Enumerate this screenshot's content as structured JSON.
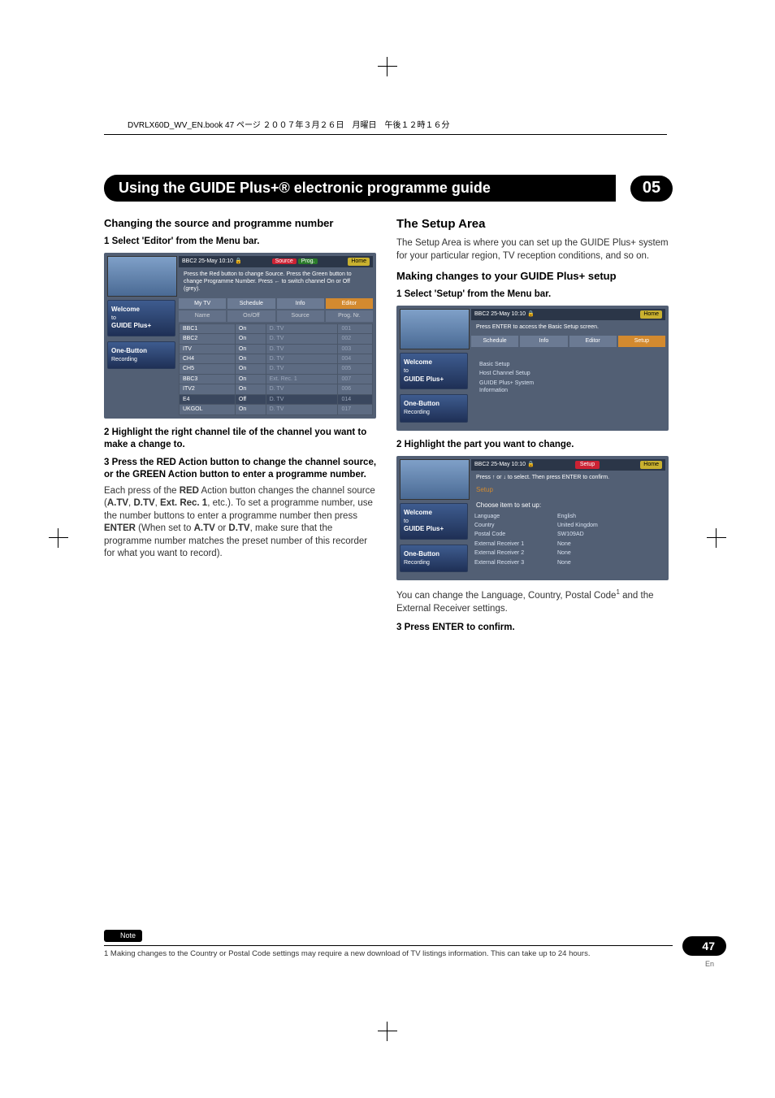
{
  "file_header": "DVRLX60D_WV_EN.book  47 ページ  ２００７年３月２６日　月曜日　午後１２時１６分",
  "page_number": "47",
  "page_lang": "En",
  "chapter_number": "05",
  "chapter_title": "Using the GUIDE Plus+® electronic programme guide",
  "left_col": {
    "heading": "Changing the source and programme number",
    "step1": "1   Select 'Editor' from the Menu bar.",
    "step2": "2   Highlight the right channel tile of the channel you want to make a change to.",
    "step3": "3   Press the RED Action button to change the channel source, or the GREEN Action button to enter a programme number.",
    "body1a": "Each press of the ",
    "body1b": " Action button changes the channel source (",
    "body1c": ", etc.). To set a programme number, use the number buttons to enter a programme number then press ",
    "body1d": " (When set to ",
    "body1e": " or ",
    "body1f": ", make sure that the programme number matches the preset number of this recorder for what you want to record).",
    "RED": "RED",
    "ATV": "A.TV",
    "DTV": "D.TV",
    "EXTREC": "Ext. Rec. 1",
    "ENTER": "ENTER"
  },
  "right_col": {
    "heading1": "The Setup Area",
    "body1": "The Setup Area is where you can set up the GUIDE Plus+ system for your particular region, TV reception conditions, and so on.",
    "heading2": "Making changes to your GUIDE Plus+ setup",
    "step1": "1   Select 'Setup' from the Menu bar.",
    "step2": "2   Highlight the part you want to change.",
    "body2a": "You can change the Language, Country, Postal Code",
    "body2b": " and the External Receiver settings.",
    "step3": "3   Press ENTER to confirm."
  },
  "note": {
    "label": "Note",
    "text": "1 Making changes to the Country or Postal Code settings may require a new download of TV listings information. This can take up to 24 hours."
  },
  "screenshots": {
    "common": {
      "status": "BBC2   25-May  10:10",
      "home": "Home",
      "welcome": "Welcome",
      "to": "to",
      "guide": "GUIDE Plus+",
      "onebutton": "One-Button",
      "recording": "Recording"
    },
    "editor": {
      "hint": "Press the Red button to change Source. Press the Green button to change Programme Number. Press ← to switch channel On or Off (grey).",
      "action_source": "Source",
      "action_prog": "Prog.",
      "tabs": [
        "My TV",
        "Schedule",
        "Info",
        "Editor"
      ],
      "subtabs": [
        "Name",
        "On/Off",
        "Source",
        "Prog. Nr."
      ],
      "rows": [
        [
          "BBC1",
          "On",
          "D. TV",
          "001"
        ],
        [
          "BBC2",
          "On",
          "D. TV",
          "002"
        ],
        [
          "ITV",
          "On",
          "D. TV",
          "003"
        ],
        [
          "CH4",
          "On",
          "D. TV",
          "004"
        ],
        [
          "CH5",
          "On",
          "D. TV",
          "005"
        ],
        [
          "BBC3",
          "On",
          "Ext. Rec. 1",
          "007"
        ],
        [
          "ITV2",
          "On",
          "D. TV",
          "006"
        ],
        [
          "E4",
          "Off",
          "D. TV",
          "014"
        ],
        [
          "UKGOL",
          "On",
          "D. TV",
          "017"
        ]
      ],
      "selected_row": 7
    },
    "setup1": {
      "hint": "Press ENTER to access the Basic Setup screen.",
      "tabs": [
        "Schedule",
        "Info",
        "Editor",
        "Setup"
      ],
      "items": [
        "Basic Setup",
        "Host Channel Setup",
        "GUIDE Plus+ System Information"
      ]
    },
    "setup2": {
      "hint": "Press ↑ or ↓ to select. Then press ENTER to confirm.",
      "btn": "Setup",
      "label": "Setup",
      "choose": "Choose item to set up:",
      "rows": [
        [
          "Language",
          "English"
        ],
        [
          "Country",
          "United Kingdom"
        ],
        [
          "Postal Code",
          "SW109AD"
        ],
        [
          "External Receiver 1",
          "None"
        ],
        [
          "External Receiver 2",
          "None"
        ],
        [
          "External Receiver 3",
          "None"
        ]
      ]
    }
  }
}
